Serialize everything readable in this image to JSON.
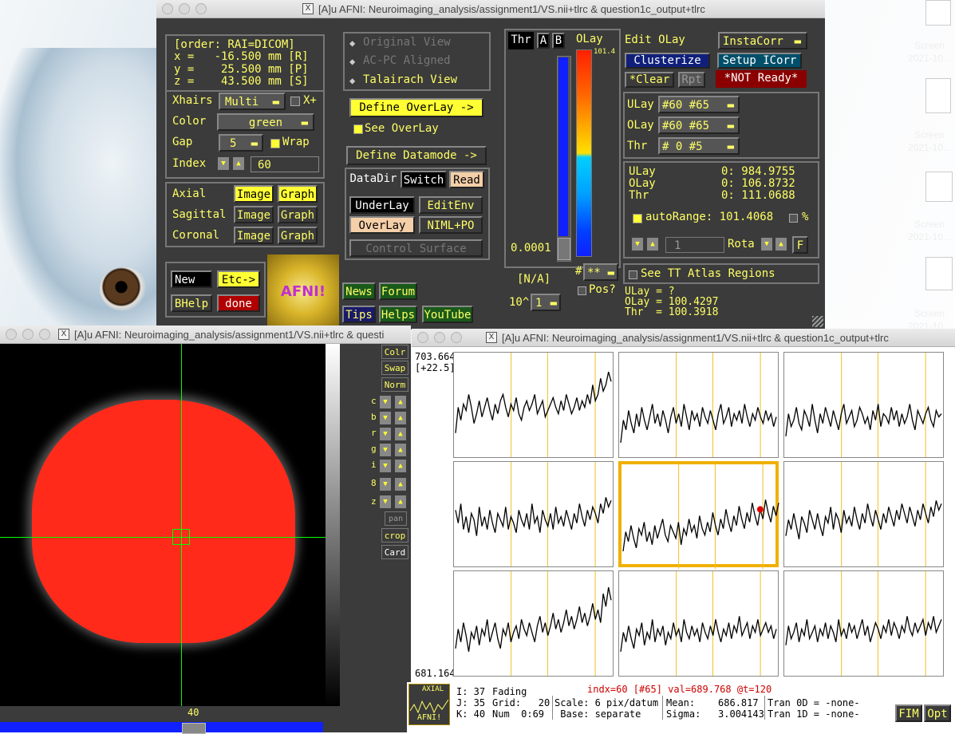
{
  "main_window": {
    "title": "[A]u AFNI: Neuroimaging_analysis/assignment1/VS.nii+tlrc & question1c_output+tlrc",
    "coords": {
      "order": "[order: RAI=DICOM]",
      "x": "x =   -16.500 mm [R]",
      "y": "y =    25.500 mm [P]",
      "z": "z =    43.500 mm [S]"
    },
    "xhairs_label": "Xhairs",
    "xhairs_value": "Multi",
    "xplus_label": "X+",
    "color_label": "Color",
    "color_value": "green",
    "gap_label": "Gap",
    "gap_value": "5",
    "wrap_label": "Wrap",
    "index_label": "Index",
    "index_value": "60",
    "views": [
      {
        "label": "Axial",
        "image": "Image",
        "graph": "Graph"
      },
      {
        "label": "Sagittal",
        "image": "Image",
        "graph": "Graph"
      },
      {
        "label": "Coronal",
        "image": "Image",
        "graph": "Graph"
      }
    ],
    "new_label": "New",
    "etc_label": "Etc->",
    "bhelp_label": "BHelp",
    "done_label": "done",
    "logo_text": "AFNI!",
    "radio": {
      "original": "Original View",
      "acpc": "AC-PC Aligned",
      "talairach": "Talairach View"
    },
    "define_overlay": "Define OverLay ->",
    "see_overlay": "See OverLay",
    "define_datamode": "Define Datamode ->",
    "datadir": "DataDir",
    "switch": "Switch",
    "read": "Read",
    "underlay": "UnderLay",
    "editenv": "EditEnv",
    "overlay": "OverLay",
    "niml": "NIML+PO",
    "control_surface": "Control Surface",
    "links": {
      "news": "News",
      "forum": "Forum",
      "tips": "Tips",
      "helps": "Helps",
      "youtube": "YouTube"
    }
  },
  "overlay_panel": {
    "thr": "Thr",
    "a": "A",
    "b": "B",
    "olay": "OLay",
    "colorbar_top": "101.4",
    "threshold_value": "0.0001",
    "na": "[N/A]",
    "pow_label": "10^",
    "pow_value": "1",
    "hash_label": "#",
    "star_value": "**",
    "pos_label": "Pos?",
    "edit_olay": "Edit OLay",
    "instacorr": "InstaCorr",
    "clusterize": "Clusterize",
    "setup_icorr": "Setup ICorr",
    "clear": "*Clear",
    "rpt": "Rpt",
    "not_ready": "*NOT Ready*",
    "ulay_sel_label": "ULay",
    "ulay_sel": "#60 #65",
    "olay_sel_label": "OLay",
    "olay_sel": "#60 #65",
    "thr_sel_label": "Thr",
    "thr_sel": "# 0 #5",
    "vals": [
      {
        "label": "ULay",
        "value": "0: 984.9755"
      },
      {
        "label": "OLay",
        "value": "0: 106.8732"
      },
      {
        "label": "Thr",
        "value": "0: 111.0688"
      }
    ],
    "autorange": "autoRange: 101.4068",
    "percent": "%",
    "rota_value": "1",
    "rota_label": "Rota",
    "f_label": "F",
    "see_tt": "See TT Atlas Regions",
    "bottom": {
      "ulay": "ULay = ?",
      "olay": "OLay = 100.4297",
      "thr": "Thr  = 100.3918"
    }
  },
  "image_window": {
    "title": "[A]u AFNI: Neuroimaging_analysis/assignment1/VS.nii+tlrc & questi",
    "slice_label": "40",
    "side_buttons": [
      "Colr",
      "Swap",
      "Norm"
    ],
    "arrow_labels": [
      "c",
      "b",
      "r",
      "g",
      "i",
      "8",
      "z"
    ],
    "pan": "pan",
    "crop": "crop",
    "card": "Card"
  },
  "graph_window": {
    "title": "[A]u AFNI: Neuroimaging_analysis/assignment1/VS.nii+tlrc & question1c_output+tlrc",
    "ymax": "703.6649",
    "yoffset": "[+22.5]",
    "ymin": "681.1649",
    "status_line": "indx=60 [#65] val=689.768 @t=120",
    "ijk": {
      "i": "I: 37",
      "j": "J: 35",
      "k": "K: 40"
    },
    "fading": "Fading",
    "grid": "Grid:   20",
    "num": "Num  0:69",
    "scale": "Scale: 6 pix/datum",
    "base": " Base: separate",
    "mean": "Mean:    686.817",
    "sigma": "Sigma:   3.004143",
    "tran0": "Tran 0D = -none-",
    "tran1": "Tran 1D = -none-",
    "thumb_label": "AXIAL",
    "thumb_afni": "AFNI!",
    "fim": "FIM",
    "opt": "Opt",
    "series": [
      [
        18,
        26,
        22,
        27,
        25,
        30,
        26,
        21,
        24,
        28,
        23,
        26,
        29,
        25,
        22,
        27,
        24,
        28,
        30,
        26,
        23,
        27,
        25,
        29,
        24,
        22,
        26,
        28,
        25,
        27,
        30,
        24,
        26,
        28,
        23,
        25,
        27,
        29,
        26,
        24,
        28,
        25,
        30,
        27,
        24,
        26,
        29,
        25,
        28,
        26,
        30,
        27,
        33,
        28,
        30,
        35,
        31,
        33,
        37,
        34
      ],
      [
        15,
        22,
        19,
        25,
        21,
        18,
        24,
        20,
        26,
        22,
        19,
        23,
        27,
        21,
        24,
        20,
        25,
        22,
        18,
        23,
        26,
        21,
        24,
        20,
        27,
        23,
        19,
        25,
        22,
        24,
        20,
        26,
        23,
        21,
        25,
        22,
        19,
        24,
        27,
        21,
        23,
        26,
        20,
        24,
        22,
        25,
        21,
        27,
        23,
        20,
        24,
        22,
        26,
        23,
        21,
        25,
        22,
        24,
        20,
        23
      ],
      [
        17,
        24,
        20,
        22,
        26,
        21,
        19,
        25,
        23,
        20,
        27,
        22,
        18,
        24,
        21,
        26,
        23,
        20,
        25,
        22,
        19,
        24,
        27,
        21,
        23,
        25,
        20,
        22,
        26,
        24,
        21,
        23,
        19,
        25,
        22,
        27,
        20,
        24,
        23,
        21,
        26,
        22,
        25,
        20,
        24,
        21,
        23,
        27,
        22,
        19,
        25,
        23,
        21,
        24,
        26,
        22,
        20,
        25,
        23,
        24
      ],
      [
        28,
        24,
        30,
        22,
        26,
        21,
        27,
        25,
        20,
        29,
        23,
        26,
        22,
        28,
        24,
        21,
        27,
        25,
        23,
        29,
        22,
        26,
        24,
        21,
        28,
        25,
        23,
        27,
        22,
        30,
        24,
        26,
        21,
        28,
        25,
        23,
        27,
        22,
        29,
        24,
        26,
        23,
        28,
        25,
        22,
        27,
        24,
        30,
        26,
        23,
        28,
        25,
        29,
        27,
        24,
        30,
        27,
        32,
        29,
        31
      ],
      [
        16,
        22,
        19,
        24,
        20,
        17,
        23,
        21,
        25,
        19,
        22,
        18,
        24,
        20,
        23,
        26,
        21,
        19,
        24,
        22,
        20,
        25,
        18,
        23,
        21,
        26,
        22,
        24,
        20,
        27,
        23,
        21,
        25,
        22,
        28,
        24,
        21,
        26,
        23,
        29,
        25,
        22,
        27,
        24,
        30,
        26,
        23,
        28,
        25,
        31,
        27,
        24,
        29,
        26,
        32,
        28,
        25,
        30,
        27,
        31
      ],
      [
        20,
        25,
        22,
        27,
        23,
        19,
        26,
        24,
        21,
        28,
        25,
        22,
        27,
        23,
        20,
        26,
        24,
        29,
        22,
        27,
        25,
        21,
        28,
        24,
        26,
        23,
        29,
        25,
        22,
        27,
        24,
        30,
        26,
        23,
        28,
        25,
        22,
        27,
        24,
        29,
        26,
        23,
        28,
        25,
        30,
        27,
        24,
        29,
        26,
        23,
        28,
        25,
        30,
        27,
        24,
        29,
        26,
        31,
        28,
        30
      ],
      [
        19,
        25,
        21,
        27,
        23,
        18,
        24,
        22,
        26,
        20,
        25,
        23,
        28,
        21,
        24,
        27,
        22,
        19,
        25,
        23,
        27,
        21,
        24,
        26,
        22,
        28,
        25,
        23,
        27,
        24,
        21,
        26,
        29,
        24,
        27,
        23,
        26,
        30,
        25,
        28,
        24,
        27,
        31,
        26,
        29,
        25,
        28,
        32,
        27,
        30,
        26,
        29,
        33,
        28,
        31,
        27,
        36,
        32,
        38,
        34
      ],
      [
        18,
        24,
        21,
        26,
        22,
        19,
        25,
        23,
        27,
        20,
        24,
        22,
        28,
        21,
        25,
        23,
        26,
        20,
        24,
        22,
        27,
        23,
        25,
        21,
        28,
        24,
        22,
        26,
        23,
        25,
        21,
        27,
        24,
        22,
        26,
        23,
        28,
        24,
        21,
        25,
        23,
        27,
        22,
        26,
        24,
        29,
        23,
        25,
        27,
        22,
        26,
        24,
        28,
        23,
        25,
        27,
        24,
        26,
        22,
        25
      ],
      [
        20,
        26,
        22,
        24,
        27,
        21,
        25,
        23,
        28,
        22,
        24,
        26,
        21,
        25,
        23,
        27,
        22,
        26,
        24,
        21,
        28,
        23,
        25,
        22,
        27,
        24,
        26,
        22,
        25,
        28,
        23,
        26,
        21,
        24,
        27,
        25,
        22,
        26,
        24,
        28,
        23,
        27,
        25,
        22,
        26,
        24,
        29,
        25,
        23,
        27,
        24,
        26,
        28,
        23,
        27,
        25,
        29,
        24,
        26,
        28
      ]
    ]
  },
  "desktop": {
    "items": [
      "Screen",
      "2021-10...",
      "Screen",
      "2021-10...",
      "Screen",
      "2021-10...",
      "Screen",
      "2021-10..."
    ]
  }
}
